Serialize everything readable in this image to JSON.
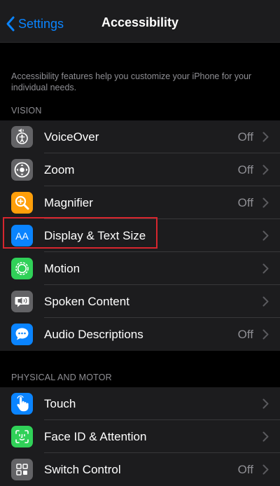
{
  "nav": {
    "back_label": "Settings",
    "title": "Accessibility"
  },
  "description": "Accessibility features help you customize your iPhone for your individual needs.",
  "vision": {
    "header": "VISION",
    "items": [
      {
        "label": "VoiceOver",
        "value": "Off",
        "icon": "voiceover-icon",
        "color": "#636366"
      },
      {
        "label": "Zoom",
        "value": "Off",
        "icon": "zoom-icon",
        "color": "#636366"
      },
      {
        "label": "Magnifier",
        "value": "Off",
        "icon": "magnifier-icon",
        "color": "#ff9f0a"
      },
      {
        "label": "Display & Text Size",
        "value": "",
        "icon": "display-text-size-icon",
        "color": "#0a84ff"
      },
      {
        "label": "Motion",
        "value": "",
        "icon": "motion-icon",
        "color": "#30d158"
      },
      {
        "label": "Spoken Content",
        "value": "",
        "icon": "spoken-content-icon",
        "color": "#636366"
      },
      {
        "label": "Audio Descriptions",
        "value": "Off",
        "icon": "audio-descriptions-icon",
        "color": "#0a84ff"
      }
    ]
  },
  "physical": {
    "header": "PHYSICAL AND MOTOR",
    "items": [
      {
        "label": "Touch",
        "value": "",
        "icon": "touch-icon",
        "color": "#0a84ff"
      },
      {
        "label": "Face ID & Attention",
        "value": "",
        "icon": "face-id-icon",
        "color": "#30d158"
      },
      {
        "label": "Switch Control",
        "value": "Off",
        "icon": "switch-control-icon",
        "color": "#636366"
      }
    ]
  }
}
